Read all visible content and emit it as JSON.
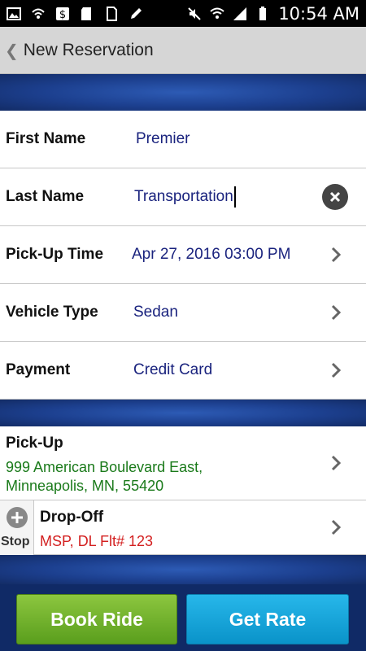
{
  "status_bar": {
    "time": "10:54 AM"
  },
  "header": {
    "back_icon": "chevron-left-icon",
    "title": "New Reservation"
  },
  "form": {
    "first_name": {
      "label": "First Name",
      "value": "Premier"
    },
    "last_name": {
      "label": "Last Name",
      "value": "Transportation"
    },
    "pickup_time": {
      "label": "Pick-Up Time",
      "value": "Apr 27, 2016 03:00 PM"
    },
    "vehicle_type": {
      "label": "Vehicle Type",
      "value": "Sedan"
    },
    "payment": {
      "label": "Payment",
      "value": "Credit Card"
    }
  },
  "locations": {
    "pickup": {
      "title": "Pick-Up",
      "address_line1": "999 American Boulevard East,",
      "address_line2": "Minneapolis, MN, 55420",
      "color": "#1a7a1a"
    },
    "dropoff": {
      "stop_label": "Stop",
      "title": "Drop-Off",
      "address": "MSP, DL Flt# 123",
      "color": "#d32020"
    }
  },
  "buttons": {
    "book": "Book Ride",
    "rate": "Get Rate"
  }
}
